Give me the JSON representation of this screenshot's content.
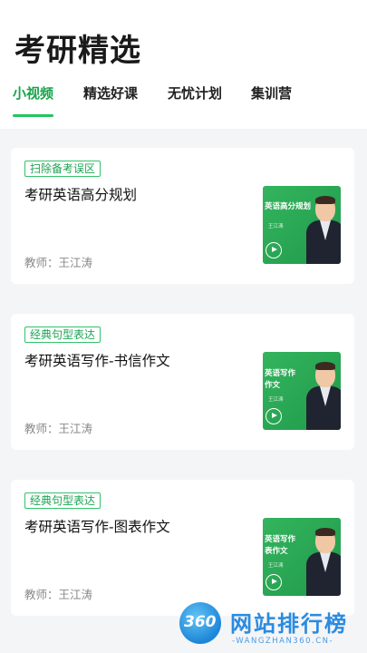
{
  "page_title": "考研精选",
  "tabs": [
    {
      "label": "小视频",
      "active": true
    },
    {
      "label": "精选好课",
      "active": false
    },
    {
      "label": "无忧计划",
      "active": false
    },
    {
      "label": "集训营",
      "active": false
    }
  ],
  "accent_color": "#22c55e",
  "cards": [
    {
      "tag": "扫除备考误区",
      "title": "考研英语高分规划",
      "teacher": "教师：王江涛",
      "thumb_lines": [
        "英语高分规划"
      ],
      "thumb_name": "王江涛"
    },
    {
      "tag": "经典句型表达",
      "title": "考研英语写作-书信作文",
      "teacher": "教师：王江涛",
      "thumb_lines": [
        "英语写作",
        "作文"
      ],
      "thumb_name": "王江涛"
    },
    {
      "tag": "经典句型表达",
      "title": "考研英语写作-图表作文",
      "teacher": "教师：王江涛",
      "thumb_lines": [
        "英语写作",
        "表作文"
      ],
      "thumb_name": "王江涛"
    }
  ],
  "watermark": {
    "logo": "360",
    "text": "网站排行榜",
    "sub": "-WANGZHAN360.CN-"
  }
}
